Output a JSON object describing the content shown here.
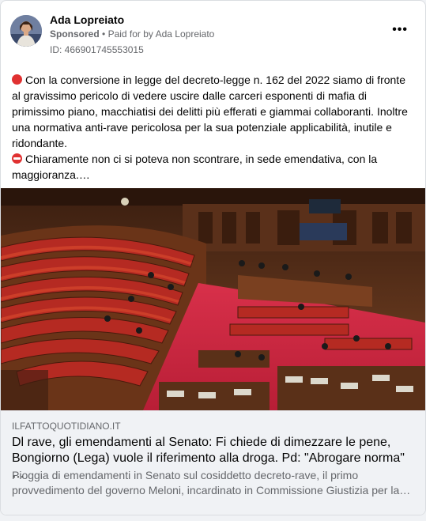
{
  "post": {
    "author": "Ada Lopreiato",
    "sponsored_label": "Sponsored",
    "separator": "•",
    "paid_for_prefix": "Paid for by",
    "paid_for_name": "Ada Lopreiato",
    "ad_id": "ID: 466901745553015",
    "more_label": "•••",
    "paragraph1": "Con la conversione in legge del decreto-legge n. 162 del 2022 siamo di fronte al gravissimo pericolo di vedere uscire dalle carceri esponenti di mafia di primissimo piano, macchiatisi dei delitti più efferati e giammai collaboranti. Inoltre una normativa anti-rave pericolosa per la sua potenziale applicabilità, inutile e ridondante.",
    "paragraph2": "Chiaramente non ci si poteva non scontrare, in sede emendativa, con la maggioranza.…",
    "bullet1_icon": "red-circle-icon",
    "bullet2_icon": "no-entry-icon"
  },
  "link": {
    "domain": "ILFATTOQUOTIDIANO.IT",
    "title": "Dl rave, gli emendamenti al Senato: Fi chiede di dimezzare le pene, Bongiorno (Lega) vuole il riferimento alla droga. Pd: \"Abrogare norma\" …",
    "description": "Pioggia di emendamenti in Senato sul cosiddetto decreto-rave, il primo provvedimento del governo Meloni, incardinato in Commissione Giustizia per la…"
  },
  "colors": {
    "chamber_seats": "#b52a22",
    "chamber_floor": "#c8283a",
    "wood": "#6b3a1e"
  }
}
